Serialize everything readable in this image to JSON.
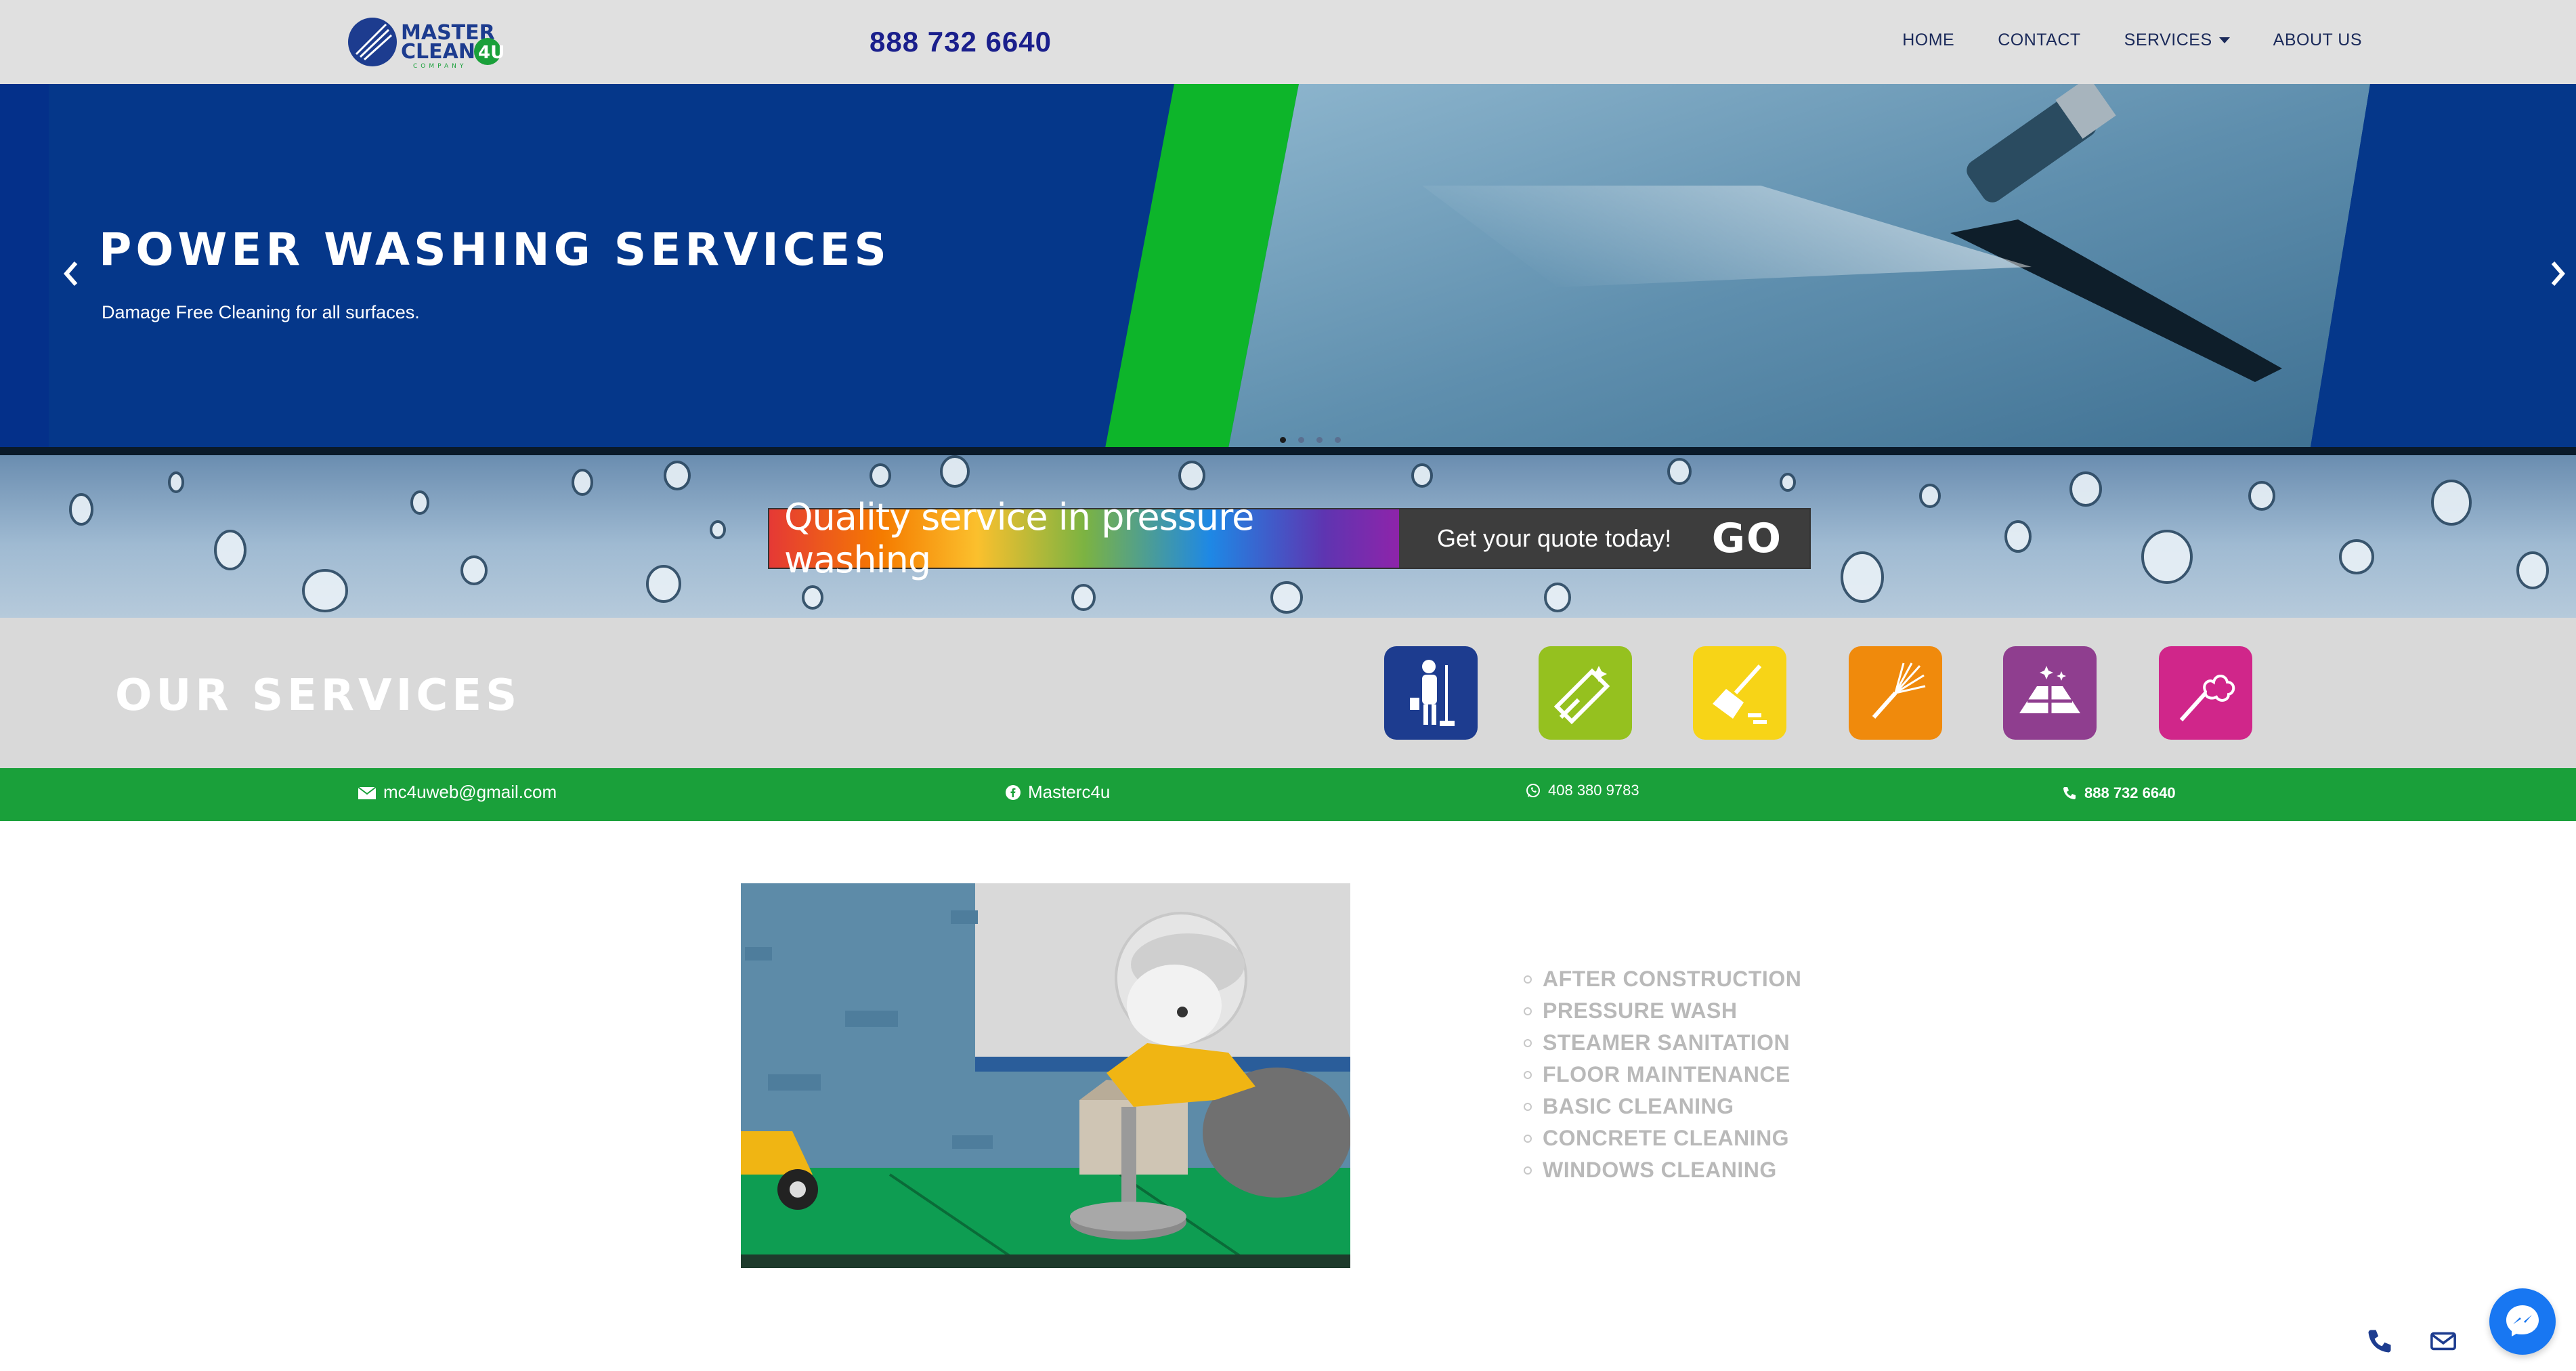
{
  "header": {
    "logo_text": "MASTER CLEAN 4U COMPANY",
    "phone": "888 732 6640",
    "nav": {
      "home": "HOME",
      "contact": "CONTACT",
      "services": "SERVICES",
      "about": "ABOUT US"
    }
  },
  "hero": {
    "title": "POWER WASHING SERVICES",
    "subtitle": "Damage Free Cleaning for all surfaces.",
    "prev_icon": "chevron-left-icon",
    "next_icon": "chevron-right-icon",
    "slides": 4,
    "active_slide": 1
  },
  "promo": {
    "headline": "Quality service in pressure washing",
    "cta": "Get your quote today!",
    "go": "GO"
  },
  "services_strip": {
    "title": "OUR SERVICES",
    "icons": [
      {
        "name": "janitor-icon",
        "color": "#1d3c8f"
      },
      {
        "name": "window-squeegee-icon",
        "color": "#95c11f"
      },
      {
        "name": "broom-icon",
        "color": "#f7d417"
      },
      {
        "name": "whisk-broom-icon",
        "color": "#f08a0c"
      },
      {
        "name": "floor-shine-icon",
        "color": "#8f3e8f"
      },
      {
        "name": "steam-spray-icon",
        "color": "#d0268a"
      }
    ]
  },
  "contact_bar": {
    "email": "mc4uweb@gmail.com",
    "facebook": "Masterc4u",
    "whatsapp": "408 380 9783",
    "phone": "888 732 6640"
  },
  "service_list": [
    "AFTER CONSTRUCTION",
    "PRESSURE WASH",
    "STEAMER SANITATION",
    "FLOOR MAINTENANCE",
    "BASIC CLEANING",
    "CONCRETE CLEANING",
    "WINDOWS CLEANING"
  ],
  "colors": {
    "header_bg": "#e0e0e0",
    "hero_blue": "#05378a",
    "accent_green": "#1aa03a",
    "phone_text": "#1a1f8c"
  }
}
